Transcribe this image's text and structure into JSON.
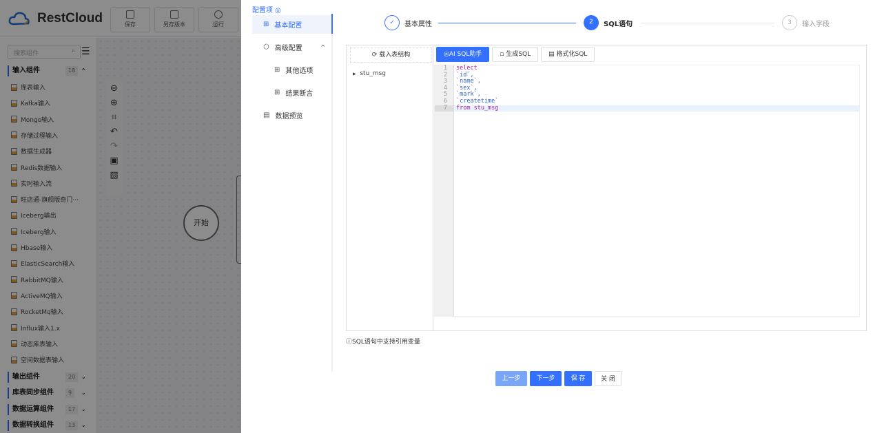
{
  "app": {
    "logo": "RestCloud",
    "toolbar": [
      {
        "label": "保存",
        "icon": "save-icon"
      },
      {
        "label": "另存版本",
        "icon": "copy-icon"
      },
      {
        "label": "运行",
        "icon": "run-icon"
      }
    ]
  },
  "sidebar": {
    "search_placeholder": "搜索组件",
    "groups": [
      {
        "label": "输入组件",
        "count": "18"
      },
      {
        "label": "输出组件",
        "count": "20"
      },
      {
        "label": "库表同步组件",
        "count": "9"
      },
      {
        "label": "数据运算组件",
        "count": "17"
      },
      {
        "label": "数据转换组件",
        "count": "13"
      }
    ],
    "items": [
      "库表输入",
      "Kafka输入",
      "Mongo输入",
      "存储过程输入",
      "数据生成器",
      "Redis数据输入",
      "实时输入流",
      "旺店通-旗舰版奇门···",
      "Iceberg输出",
      "Iceberg输入",
      "Hbase输入",
      "ElasticSearch输入",
      "RabbitMQ输入",
      "ActiveMQ输入",
      "RocketMq输入",
      "Influx输入1.x",
      "动态库表输入",
      "空间数据表输入"
    ]
  },
  "canvas": {
    "start_node": "开始"
  },
  "drawer": {
    "config_title": "配置项 ◎",
    "menu": [
      {
        "label": "基本配置"
      },
      {
        "label": "高级配置"
      },
      {
        "label": "其他选项"
      },
      {
        "label": "结果断言"
      },
      {
        "label": "数据预览"
      }
    ],
    "steps": [
      {
        "num": "✓",
        "label": "基本属性",
        "state": "done"
      },
      {
        "num": "2",
        "label": "SQL语句",
        "state": "active"
      },
      {
        "num": "3",
        "label": "输入字段",
        "state": "pending"
      }
    ],
    "load_button": "载入表结构",
    "tree_node": "stu_msg",
    "tools": [
      "AI SQL助手",
      "生成SQL",
      "格式化SQL"
    ],
    "code": [
      [
        "kw",
        "select"
      ],
      [
        "str",
        "`id`,"
      ],
      [
        "str",
        "`name`,"
      ],
      [
        "str",
        "`sex`,"
      ],
      [
        "str",
        "`mark`,"
      ],
      [
        "str",
        "`createtime`"
      ],
      [
        "kw",
        "from stu_msg"
      ]
    ],
    "hint": "SQL语句中支持引用变量",
    "footer": {
      "prev": "上一步",
      "next": "下一步",
      "save": "保 存",
      "close": "关 闭"
    },
    "colors": {
      "accent": "#3370ff",
      "prev_disabled": "#79a6f7"
    }
  }
}
